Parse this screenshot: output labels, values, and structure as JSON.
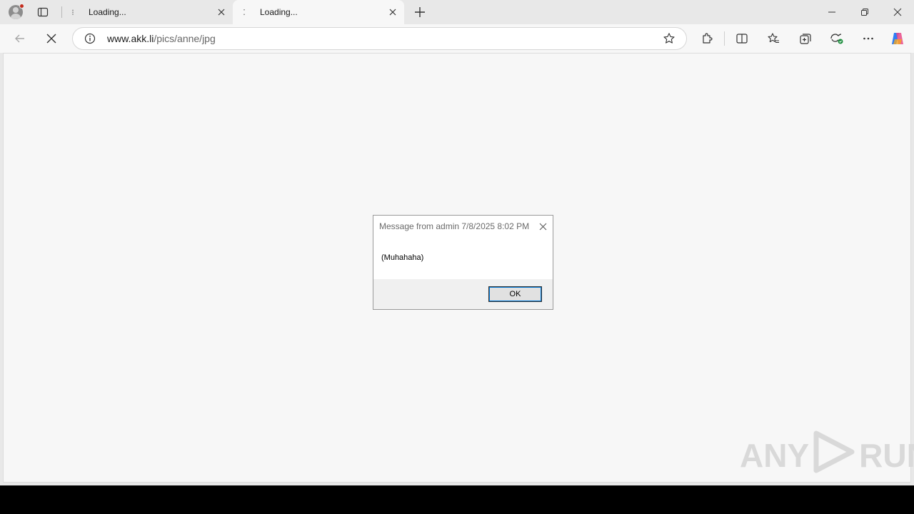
{
  "tabs": [
    {
      "title": "Loading..."
    },
    {
      "title": "Loading..."
    }
  ],
  "address": {
    "host": "www.akk.li",
    "path": "/pics/anne/jpg"
  },
  "dialog": {
    "title": "Message from admin 7/8/2025 8:02 PM",
    "message": "(Muhahaha)",
    "ok_label": "OK"
  },
  "watermark": {
    "left": "ANY",
    "right": "RUN"
  },
  "colors": {
    "chrome_bg": "#e8e8e8",
    "page_bg": "#f7f7f7",
    "accent": "#0078d7"
  }
}
